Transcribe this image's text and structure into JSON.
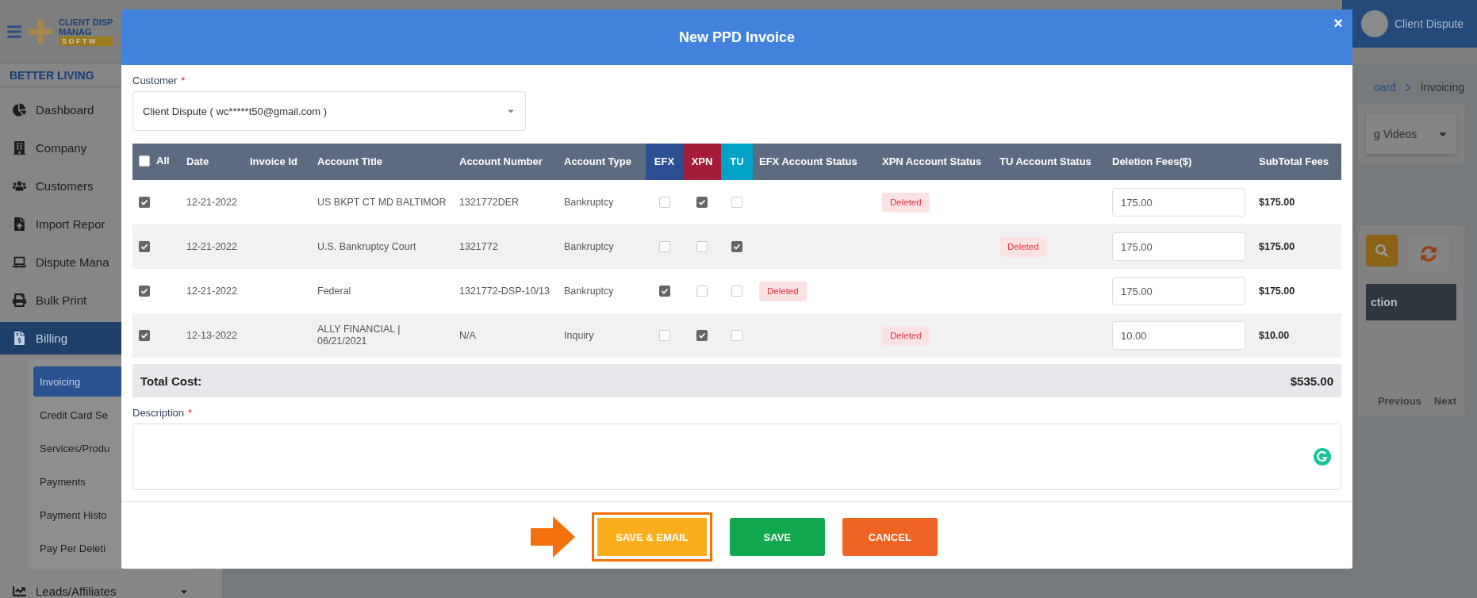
{
  "top_bar": {
    "logo": [
      "CLIENT DISP",
      "MANAG",
      "S O F T W"
    ],
    "user": "Client Dispute"
  },
  "sidebar": {
    "company": "BETTER LIVING",
    "items": [
      {
        "label": "Dashboard",
        "selected": false
      },
      {
        "label": "Company",
        "selected": false
      },
      {
        "label": "Customers",
        "selected": false
      },
      {
        "label": "Import Repor",
        "selected": false
      },
      {
        "label": "Dispute Mana",
        "selected": false
      },
      {
        "label": "Bulk Print",
        "selected": false
      },
      {
        "label": "Billing",
        "selected": true,
        "children": [
          {
            "label": "Invoicing",
            "selected": true
          },
          {
            "label": "Credit Card Se",
            "selected": false
          },
          {
            "label": "Services/Produ",
            "selected": false
          },
          {
            "label": "Payments",
            "selected": false
          },
          {
            "label": "Payment Histo",
            "selected": false
          },
          {
            "label": "Pay Per Deleti",
            "selected": false
          }
        ]
      },
      {
        "label": "Leads/Affiliates",
        "selected": false,
        "caret": true
      }
    ]
  },
  "breadcrumb": [
    "oard",
    "Invoicing"
  ],
  "video_select": "g Videos",
  "panel": {
    "header": "ction",
    "pager": [
      "Previous",
      "Next"
    ]
  },
  "modal": {
    "title": "New PPD Invoice",
    "close": "×",
    "customer": {
      "label": "Customer",
      "required_mark": "*",
      "value": "Client Dispute ( wc*****t50@gmail.com )"
    },
    "table": {
      "select_all": {
        "label": "All",
        "checked": false
      },
      "columns": [
        {
          "label": "Date"
        },
        {
          "label": "Invoice Id"
        },
        {
          "label": "Account Title"
        },
        {
          "label": "Account Number"
        },
        {
          "label": "Account Type"
        },
        {
          "label": "EFX",
          "color": "#2c4f93"
        },
        {
          "label": "XPN",
          "color": "#a31c38"
        },
        {
          "label": "TU",
          "color": "#00a2c7"
        },
        {
          "label": "EFX Account Status"
        },
        {
          "label": "XPN Account Status"
        },
        {
          "label": "TU Account Status"
        },
        {
          "label": "Deletion Fees($)"
        },
        {
          "label": "SubTotal Fees"
        }
      ],
      "rows": [
        {
          "checked": true,
          "date": "12-21-2022",
          "account_title": "US BKPT CT MD BALTIMOR",
          "account_number": "1321772DER",
          "account_type": "Bankruptcy",
          "efx": false,
          "xpn": true,
          "tu": false,
          "xpn_status": "Deleted",
          "fee": "175.00",
          "subtotal": "$175.00"
        },
        {
          "checked": true,
          "date": "12-21-2022",
          "account_title": "U.S. Bankruptcy Court",
          "account_number": "1321772",
          "account_type": "Bankruptcy",
          "efx": false,
          "xpn": false,
          "tu": true,
          "tu_status": "Deleted",
          "fee": "175.00",
          "subtotal": "$175.00"
        },
        {
          "checked": true,
          "date": "12-21-2022",
          "account_title": "Federal",
          "account_number": "1321772-DSP-10/13",
          "account_type": "Bankruptcy",
          "efx": true,
          "xpn": false,
          "tu": false,
          "efx_status": "Deleted",
          "fee": "175.00",
          "subtotal": "$175.00"
        },
        {
          "checked": true,
          "date": "12-13-2022",
          "account_title": "ALLY FINANCIAL | 06/21/2021",
          "account_number": "N/A",
          "account_type": "Inquiry",
          "efx": false,
          "xpn": true,
          "tu": false,
          "xpn_status": "Deleted",
          "fee": "10.00",
          "subtotal": "$10.00"
        }
      ],
      "total": {
        "label": "Total Cost:",
        "value": "$535.00"
      }
    },
    "description": {
      "label": "Description",
      "required_mark": "*"
    },
    "buttons": [
      {
        "label": "SAVE & EMAIL",
        "kind": "email",
        "highlighted": true
      },
      {
        "label": "SAVE",
        "kind": "save",
        "highlighted": false
      },
      {
        "label": "CANCEL",
        "kind": "cancel",
        "highlighted": false
      }
    ]
  }
}
